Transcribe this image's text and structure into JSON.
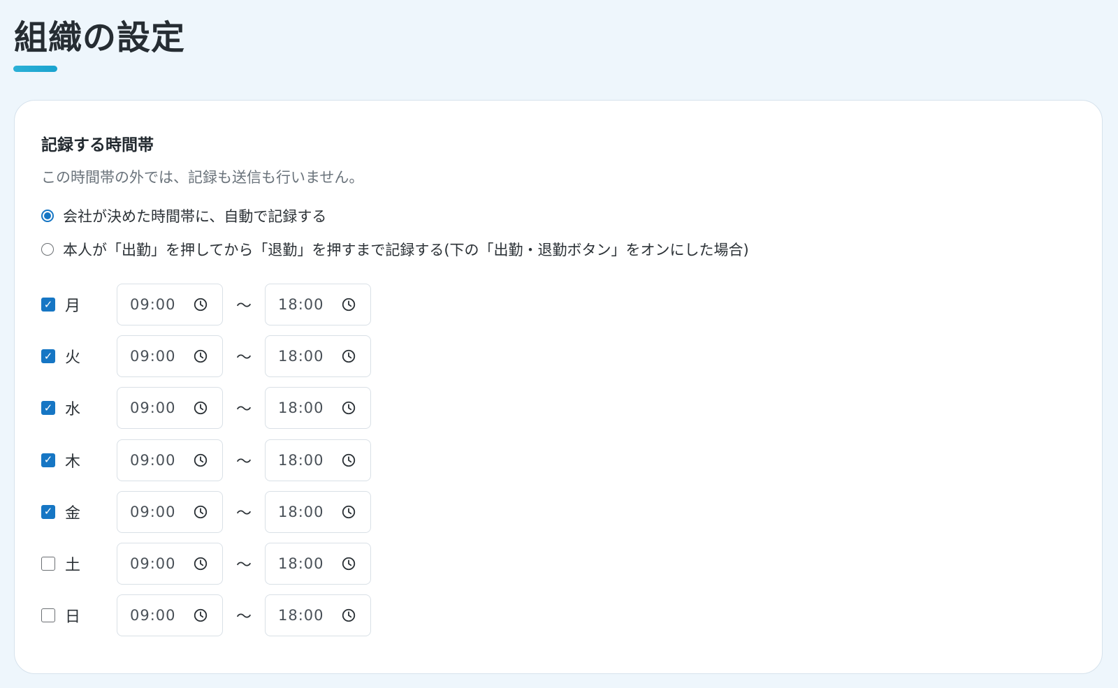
{
  "page": {
    "title": "組織の設定"
  },
  "section": {
    "title": "記録する時間帯",
    "description": "この時間帯の外では、記録も送信も行いません。"
  },
  "options": [
    {
      "label": "会社が決めた時間帯に、自動で記録する",
      "selected": true
    },
    {
      "label": "本人が「出勤」を押してから「退勤」を押すまで記録する(下の「出勤・退勤ボタン」をオンにした場合)",
      "selected": false
    }
  ],
  "separator": "〜",
  "days": [
    {
      "label": "月",
      "checked": true,
      "start": "09:00",
      "end": "18:00"
    },
    {
      "label": "火",
      "checked": true,
      "start": "09:00",
      "end": "18:00"
    },
    {
      "label": "水",
      "checked": true,
      "start": "09:00",
      "end": "18:00"
    },
    {
      "label": "木",
      "checked": true,
      "start": "09:00",
      "end": "18:00"
    },
    {
      "label": "金",
      "checked": true,
      "start": "09:00",
      "end": "18:00"
    },
    {
      "label": "土",
      "checked": false,
      "start": "09:00",
      "end": "18:00"
    },
    {
      "label": "日",
      "checked": false,
      "start": "09:00",
      "end": "18:00"
    }
  ],
  "colors": {
    "accent": "#1676c4",
    "underline": "#2bb0d6",
    "background": "#eef6fc"
  },
  "icons": {
    "time": "clock-icon",
    "check": "checkmark-icon"
  }
}
